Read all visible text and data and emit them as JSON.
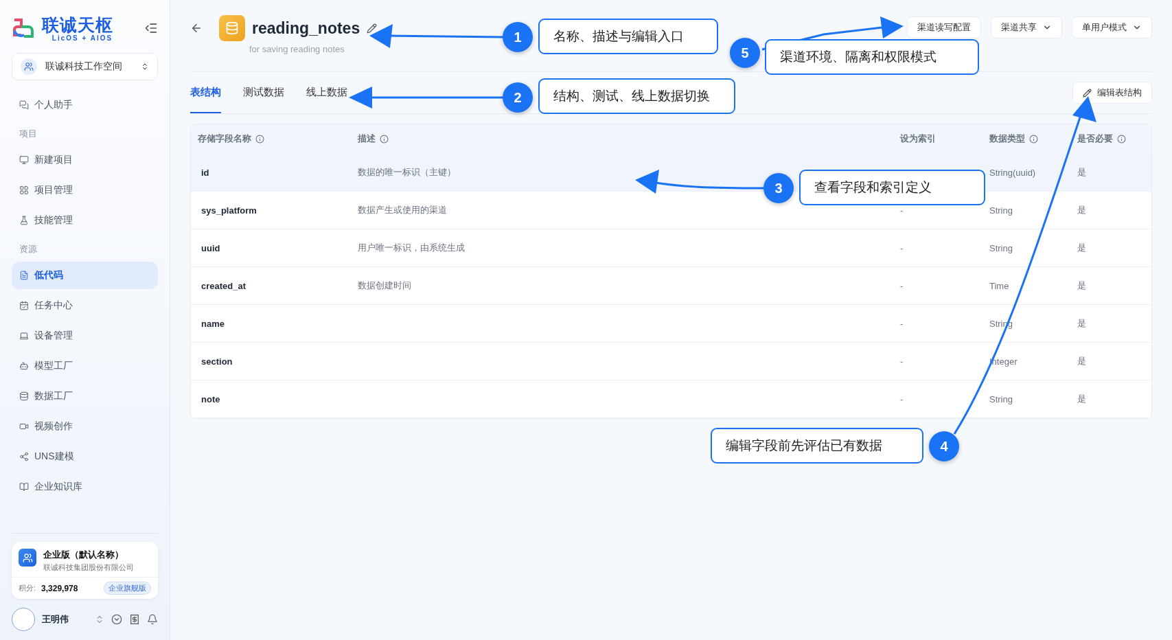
{
  "sidebar": {
    "logo": {
      "name": "联诚天枢",
      "tagline": "LicOS + AIOS"
    },
    "workspace": "联诚科技工作空间",
    "items": [
      {
        "kind": "item",
        "label": "个人助手",
        "selected": false
      },
      {
        "kind": "section",
        "label": "项目"
      },
      {
        "kind": "item",
        "label": "新建项目",
        "selected": false
      },
      {
        "kind": "item",
        "label": "项目管理",
        "selected": false
      },
      {
        "kind": "item",
        "label": "技能管理",
        "selected": false
      },
      {
        "kind": "section",
        "label": "资源"
      },
      {
        "kind": "item",
        "label": "低代码",
        "selected": true
      },
      {
        "kind": "item",
        "label": "任务中心",
        "selected": false
      },
      {
        "kind": "item",
        "label": "设备管理",
        "selected": false
      },
      {
        "kind": "item",
        "label": "模型工厂",
        "selected": false
      },
      {
        "kind": "item",
        "label": "数据工厂",
        "selected": false
      },
      {
        "kind": "item",
        "label": "视频创作",
        "selected": false
      },
      {
        "kind": "item",
        "label": "UNS建模",
        "selected": false
      },
      {
        "kind": "item",
        "label": "企业知识库",
        "selected": false
      }
    ],
    "plan_card": {
      "title": "企业版（默认名称）",
      "company": "联诚科技集团股份有限公司",
      "points_label": "积分:",
      "points": "3,329,978",
      "badge": "企业旗舰版"
    },
    "user": {
      "name": "王明伟"
    }
  },
  "header": {
    "title": "reading_notes",
    "subtitle": "for saving reading notes",
    "buttons": [
      {
        "label": "渠道读写配置",
        "dropdown": false
      },
      {
        "label": "渠道共享",
        "dropdown": true
      },
      {
        "label": "单用户模式",
        "dropdown": true
      }
    ]
  },
  "tabs": [
    {
      "label": "表结构",
      "selected": true
    },
    {
      "label": "测试数据",
      "selected": false
    },
    {
      "label": "线上数据",
      "selected": false
    }
  ],
  "edit_button": "编辑表结构",
  "table": {
    "columns": [
      {
        "label": "存储字段名称",
        "info": true
      },
      {
        "label": "描述",
        "info": true
      },
      {
        "label": "设为索引",
        "info": false
      },
      {
        "label": "数据类型",
        "info": true
      },
      {
        "label": "是否必要",
        "info": true
      }
    ],
    "rows": [
      {
        "selected": true,
        "cells": [
          "id",
          "数据的唯一标识（主键）",
          "",
          "String(uuid)",
          "是"
        ]
      },
      {
        "selected": false,
        "cells": [
          "sys_platform",
          "数据产生或使用的渠道",
          "-",
          "String",
          "是"
        ]
      },
      {
        "selected": false,
        "cells": [
          "uuid",
          "用户唯一标识，由系统生成",
          "-",
          "String",
          "是"
        ]
      },
      {
        "selected": false,
        "cells": [
          "created_at",
          "数据创建时间",
          "-",
          "Time",
          "是"
        ]
      },
      {
        "selected": false,
        "cells": [
          "name",
          "",
          "-",
          "String",
          "是"
        ]
      },
      {
        "selected": false,
        "cells": [
          "section",
          "",
          "-",
          "Integer",
          "是"
        ]
      },
      {
        "selected": false,
        "cells": [
          "note",
          "",
          "-",
          "String",
          "是"
        ]
      }
    ]
  },
  "callouts": [
    {
      "number": "1",
      "text": "名称、描述与编辑入口"
    },
    {
      "number": "5",
      "text": "渠道环境、隔离和权限模式"
    },
    {
      "number": "2",
      "text": "结构、测试、线上数据切换"
    },
    {
      "number": "3",
      "text": "查看字段和索引定义"
    },
    {
      "number": "4",
      "text": "编辑字段前先评估已有数据"
    }
  ]
}
